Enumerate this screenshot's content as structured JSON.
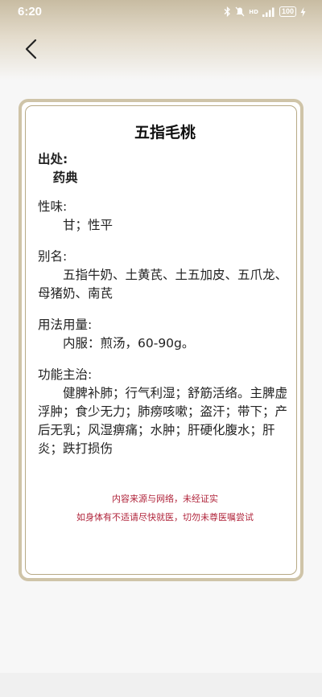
{
  "status_bar": {
    "time": "6:20",
    "signal_text": "HD",
    "battery": "100"
  },
  "herb": {
    "title": "五指毛桃",
    "source_label": "出处:",
    "source_value": "药典",
    "nature_label": "性味:",
    "nature_value": "甘；性平",
    "alias_label": "别名:",
    "alias_value": "五指牛奶、土黄芪、土五加皮、五爪龙、母猪奶、南芪",
    "usage_label": "用法用量:",
    "usage_value": "内服：煎汤，60-90g。",
    "function_label": "功能主治:",
    "function_value": "健脾补肺；行气利湿；舒筋活络。主脾虚浮肿；食少无力；肺痨咳嗽；盗汗；带下；产后无乳；风湿痹痛；水肿；肝硬化腹水；肝炎；跌打损伤"
  },
  "notices": {
    "line1": "内容来源与网络，未经证实",
    "line2": "如身体有不适请尽快就医，切勿未尊医嘱尝试"
  },
  "colors": {
    "header_gradient": "#c8bca2",
    "card_border": "#cfc4a8",
    "notice_text": "#b0243b"
  }
}
